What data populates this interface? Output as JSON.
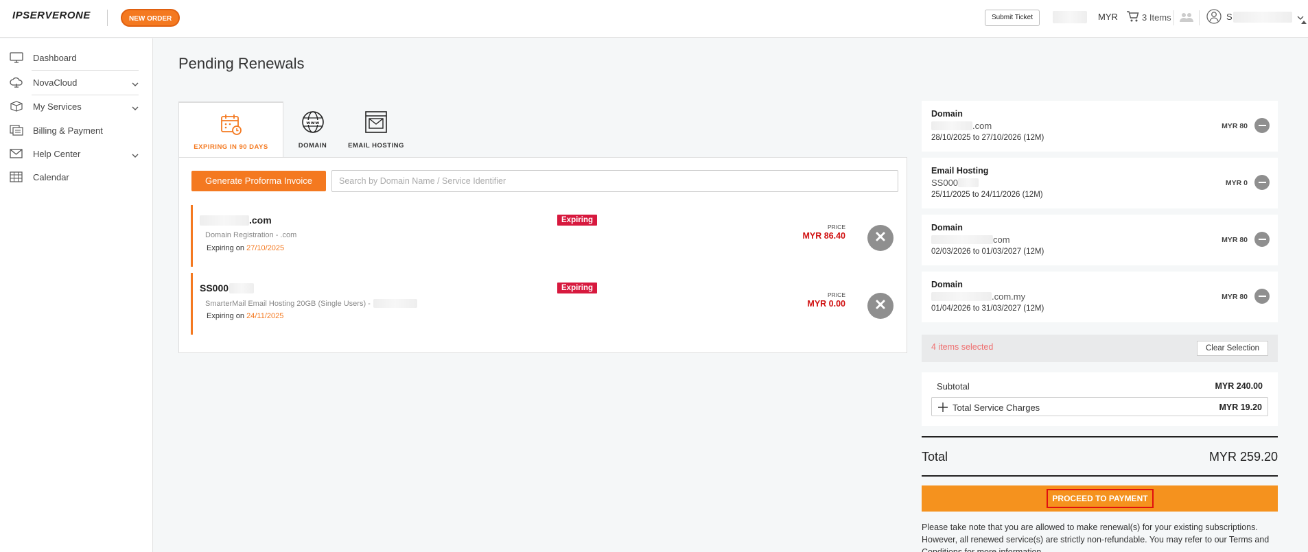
{
  "header": {
    "logo": "IPSERVERONE",
    "new_order": "NEW ORDER",
    "submit_ticket": "Submit Ticket",
    "currency": "MYR",
    "cart_label": "3 Items",
    "user_name": "S"
  },
  "sidebar": {
    "items": [
      {
        "label": "Dashboard",
        "icon": "monitor-icon"
      },
      {
        "label": "NovaCloud",
        "icon": "cloud-icon"
      },
      {
        "label": "My Services",
        "icon": "box-icon"
      },
      {
        "label": "Billing & Payment",
        "icon": "billing-icon"
      },
      {
        "label": "Help Center",
        "icon": "mail-icon"
      },
      {
        "label": "Calendar",
        "icon": "calendar-icon"
      }
    ]
  },
  "page": {
    "title": "Pending Renewals"
  },
  "tabs": [
    {
      "label": "EXPIRING IN 90 DAYS",
      "active": true
    },
    {
      "label": "DOMAIN",
      "active": false
    },
    {
      "label": "EMAIL HOSTING",
      "active": false
    }
  ],
  "toolbar": {
    "generate_label": "Generate Proforma Invoice",
    "search_placeholder": "Search by Domain Name / Service Identifier"
  },
  "services": [
    {
      "name": ".com",
      "description": "Domain Registration - .com",
      "expiring_prefix": "Expiring on",
      "expiry_date": "27/10/2025",
      "badge": "Expiring",
      "price_label": "PRICE",
      "price": "MYR 86.40"
    },
    {
      "name": "SS000",
      "description": "SmarterMail Email Hosting 20GB (Single Users) -",
      "expiring_prefix": "Expiring on",
      "expiry_date": "24/11/2025",
      "badge": "Expiring",
      "price_label": "PRICE",
      "price": "MYR 0.00"
    }
  ],
  "cart_items": [
    {
      "type": "Domain",
      "name": ".com",
      "dates": "28/10/2025 to 27/10/2026  (12M)",
      "price": "MYR 80"
    },
    {
      "type": "Email Hosting",
      "name": "SS000",
      "dates": "25/11/2025 to 24/11/2026  (12M)",
      "price": "MYR 0"
    },
    {
      "type": "Domain",
      "name": "com",
      "dates": "02/03/2026 to 01/03/2027  (12M)",
      "price": "MYR 80"
    },
    {
      "type": "Domain",
      "name": ".com.my",
      "dates": "01/04/2026 to 31/03/2027  (12M)",
      "price": "MYR 80"
    }
  ],
  "selection": {
    "text": "4 items selected",
    "clear_label": "Clear Selection"
  },
  "summary": {
    "subtotal_label": "Subtotal",
    "subtotal_value": "MYR 240.00",
    "service_charges_label": "Total Service Charges",
    "service_charges_value": "MYR 19.20",
    "total_label": "Total",
    "total_value": "MYR 259.20",
    "pay_label": "PROCEED TO PAYMENT",
    "note": "Please take note that you are allowed to make renewal(s) for your existing subscriptions. However, all renewed service(s) are strictly non-refundable. You may refer to our Terms and Conditions for more information."
  },
  "colors": {
    "accent": "#f47920",
    "badge": "#d7193e",
    "price": "#d01010",
    "pay_bar": "#f5921e"
  }
}
